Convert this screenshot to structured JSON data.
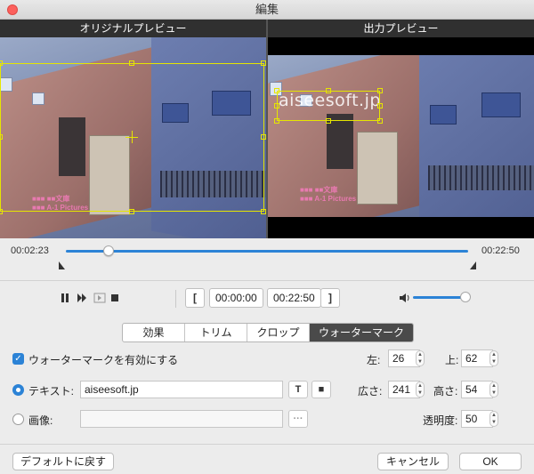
{
  "window": {
    "title": "編集"
  },
  "preview": {
    "original_label": "オリジナルプレビュー",
    "output_label": "出力プレビュー",
    "credits_line1": "■■■  ■■文庫",
    "credits_line2": "■■■  A-1 Pictures"
  },
  "timeline": {
    "current_time": "00:02:23",
    "total_time": "00:22:50",
    "position_fraction": 0.106
  },
  "controls": {
    "pause_icon": "pause-icon",
    "next_frame_icon": "next-frame-icon",
    "loop_icon": "loop-icon",
    "stop_icon": "stop-icon",
    "start_bracket": "[",
    "start_time": "00:00:00",
    "end_time": "00:22:50",
    "end_bracket": "]",
    "volume_icon": "speaker-icon",
    "volume_fraction": 0.92
  },
  "tabs": [
    {
      "label": "効果",
      "active": false
    },
    {
      "label": "トリム",
      "active": false
    },
    {
      "label": "クロップ",
      "active": false
    },
    {
      "label": "ウォーターマーク",
      "active": true
    }
  ],
  "watermark": {
    "enable_label": "ウォーターマークを有効にする",
    "enabled": true,
    "text_label": "テキスト:",
    "text_value": "aiseesoft.jp",
    "text_selected": true,
    "text_style_btn": "T",
    "text_color_btn": "■",
    "image_label": "画像:",
    "image_value": "",
    "image_browse_btn": "···",
    "left_label": "左:",
    "left_value": "26",
    "top_label": "上:",
    "top_value": "62",
    "width_label": "広さ:",
    "width_value": "241",
    "height_label": "高さ:",
    "height_value": "54",
    "opacity_label": "透明度:",
    "opacity_value": "50"
  },
  "footer": {
    "reset_label": "デフォルトに戻す",
    "cancel_label": "キャンセル",
    "ok_label": "OK"
  },
  "colors": {
    "accent": "#2c83d6",
    "selection": "#e6e600",
    "credits": "#e87ab0"
  }
}
